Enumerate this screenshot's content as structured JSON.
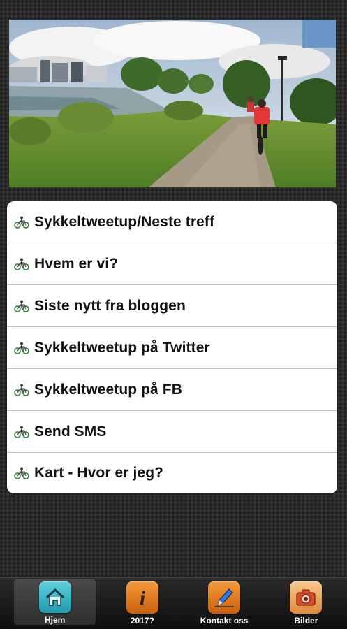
{
  "hero": {
    "alt": "Cyclists on a park path by a lake"
  },
  "menu": {
    "items": [
      {
        "label": "Sykkeltweetup/Neste treff",
        "icon": "bicycle-icon"
      },
      {
        "label": "Hvem er vi?",
        "icon": "bicycle-icon"
      },
      {
        "label": "Siste nytt fra bloggen",
        "icon": "bicycle-icon"
      },
      {
        "label": "Sykkeltweetup på Twitter",
        "icon": "bicycle-icon"
      },
      {
        "label": "Sykkeltweetup på FB",
        "icon": "bicycle-icon"
      },
      {
        "label": "Send SMS",
        "icon": "bicycle-icon"
      },
      {
        "label": "Kart - Hvor er jeg?",
        "icon": "bicycle-icon"
      }
    ]
  },
  "tabbar": {
    "tabs": [
      {
        "label": "Hjem",
        "icon": "home-icon",
        "color": "#2fb0c2",
        "active": true
      },
      {
        "label": "2017?",
        "icon": "info-icon",
        "color": "#e07a18",
        "active": false
      },
      {
        "label": "Kontakt oss",
        "icon": "pen-icon",
        "color": "#e07a18",
        "active": false
      },
      {
        "label": "Bilder",
        "icon": "camera-icon",
        "color": "#f0a860",
        "active": false
      }
    ]
  }
}
